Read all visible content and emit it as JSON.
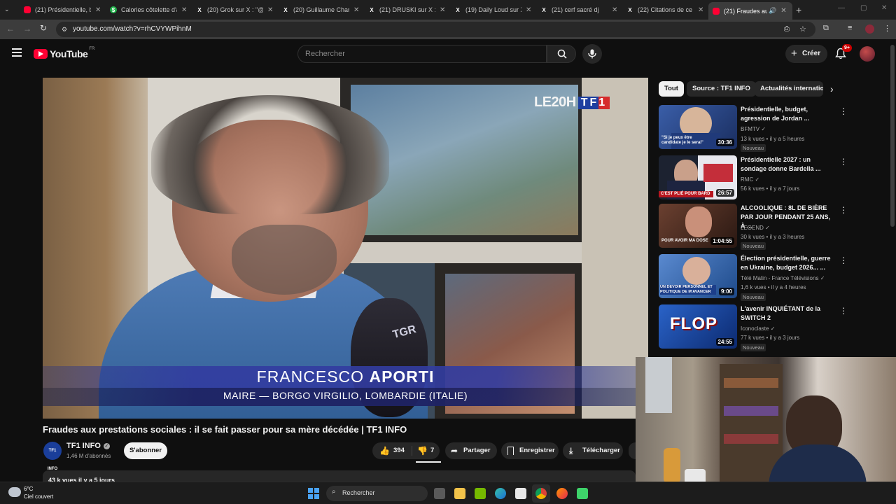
{
  "tabs": [
    {
      "title": "(21) Présidentielle, bu",
      "favicon": "youtube-icon"
    },
    {
      "title": "Calories côtelette d'a",
      "favicon": "green-leaf-icon"
    },
    {
      "title": "(20) Grok sur X : \"@re",
      "favicon": "x-icon"
    },
    {
      "title": "(20) Guillaume Cham",
      "favicon": "x-icon"
    },
    {
      "title": "(21) DRUSKI sur X : \"I",
      "favicon": "x-icon"
    },
    {
      "title": "(19) Daily Loud sur X",
      "favicon": "x-icon"
    },
    {
      "title": "(21) cerf sacré dj",
      "favicon": "x-icon"
    },
    {
      "title": "(22) Citations de ce p",
      "favicon": "x-icon"
    },
    {
      "title": "(21) Fraudes aux",
      "favicon": "youtube-icon",
      "active": true
    }
  ],
  "address": {
    "url": "youtube.com/watch?v=rhCVYWPihnM"
  },
  "youtube": {
    "logo_text": "YouTube",
    "region": "FR",
    "search_placeholder": "Rechercher",
    "create_label": "Créer",
    "notif_count": "9+"
  },
  "video": {
    "overlay_brand_a": "LE20H",
    "overlay_brand_b": "TF1",
    "mic_label": "TGR",
    "lower_third_name_a": "FRANCESCO",
    "lower_third_name_b": "APORTI",
    "lower_third_role": "MAIRE — BORGO VIRGILIO, LOMBARDIE (ITALIE)",
    "title": "Fraudes aux prestations sociales : il se fait passer pour sa mère décédée | TF1 INFO",
    "channel_avatar": "TF1 INFO",
    "channel_name": "TF1 INFO",
    "subscribers": "1,46 M d'abonnés",
    "subscribe_label": "S'abonner",
    "likes": "394",
    "dislikes": "7",
    "share_label": "Partager",
    "save_label": "Enregistrer",
    "download_label": "Télécharger",
    "meta_partial": "43 k vues  il y a 5 jours"
  },
  "chips": [
    "Tout",
    "Source : TF1 INFO",
    "Actualités internatio"
  ],
  "recommendations": [
    {
      "title": "Présidentielle, budget, agression de Jordan ...",
      "channel": "BFMTV",
      "meta": "13 k vues • il y a 5 heures",
      "badge": "Nouveau",
      "duration": "30:36",
      "thumb_color": "#2b4c88",
      "thumb_text": "\"Si je peux être candidate je le serai\""
    },
    {
      "title": "Présidentielle 2027 : un sondage donne Bardella ...",
      "channel": "RMC",
      "meta": "56 k vues • il y a 7 jours",
      "badge": "",
      "duration": "26:57",
      "thumb_color": "#6b1b2a",
      "thumb_text": "C'EST PLIÉ POUR BARD"
    },
    {
      "title": "ALCOOLIQUE : 8L DE BIÈRE PAR JOUR PENDANT 25 ANS, À ...",
      "channel": "LEGEND",
      "meta": "30 k vues • il y a 3 heures",
      "badge": "Nouveau",
      "duration": "1:04:55",
      "thumb_color": "#3a2418",
      "thumb_text": "POUR AVOIR MA DOSE"
    },
    {
      "title": "Élection présidentielle, guerre en Ukraine, budget 2026... ...",
      "channel": "Télé Matin - France Télévisions",
      "meta": "1,6 k vues • il y a 4 heures",
      "badge": "Nouveau",
      "duration": "9:00",
      "thumb_color": "#2a5d9b",
      "thumb_text": "UN DEVOIR PERSONNEL ET POLITIQUE DE M'AVANCER"
    },
    {
      "title": "L'avenir INQUIÉTANT de la SWITCH 2",
      "channel": "Iconoclaste",
      "meta": "77 k vues • il y a 3 jours",
      "badge": "Nouveau",
      "duration": "24:55",
      "thumb_color": "#1a4fb0",
      "thumb_text": "FLOP"
    }
  ],
  "taskbar": {
    "weather_temp": "6°C",
    "weather_desc": "Ciel couvert",
    "search_label": "Rechercher"
  }
}
